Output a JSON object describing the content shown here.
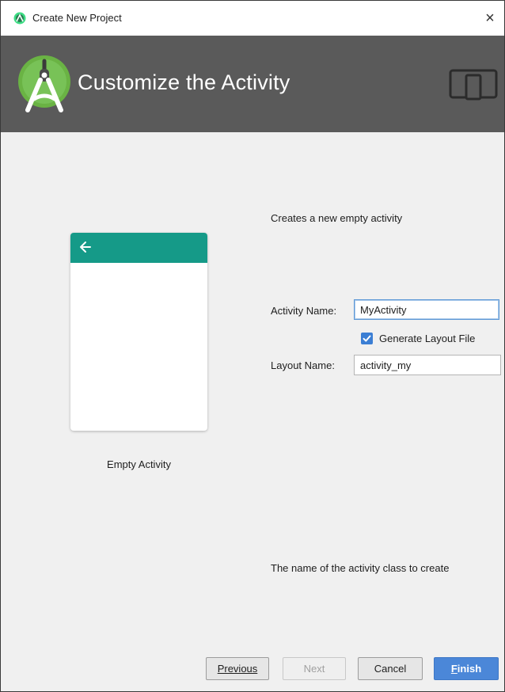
{
  "window": {
    "title": "Create New Project",
    "close_glyph": "×"
  },
  "banner": {
    "heading": "Customize the Activity",
    "logo_icon": "android-studio-icon",
    "device_icon": "phone-tablet-icon",
    "background_color": "#5a5a5a"
  },
  "template": {
    "name": "Empty Activity",
    "description": "Creates a new empty activity",
    "appbar_color": "#159a88",
    "back_icon": "arrow-left-icon"
  },
  "form": {
    "activity_name_label": "Activity Name:",
    "activity_name_value": "MyActivity",
    "generate_layout_label": "Generate Layout File",
    "generate_layout_checked": true,
    "layout_name_label": "Layout Name:",
    "layout_name_value": "activity_my"
  },
  "hint": "The name of the activity class to create",
  "buttons": {
    "previous": "Previous",
    "next": "Next",
    "cancel": "Cancel",
    "finish_mnemonic": "F",
    "finish_rest": "inish",
    "finish_color": "#4b87d8"
  }
}
